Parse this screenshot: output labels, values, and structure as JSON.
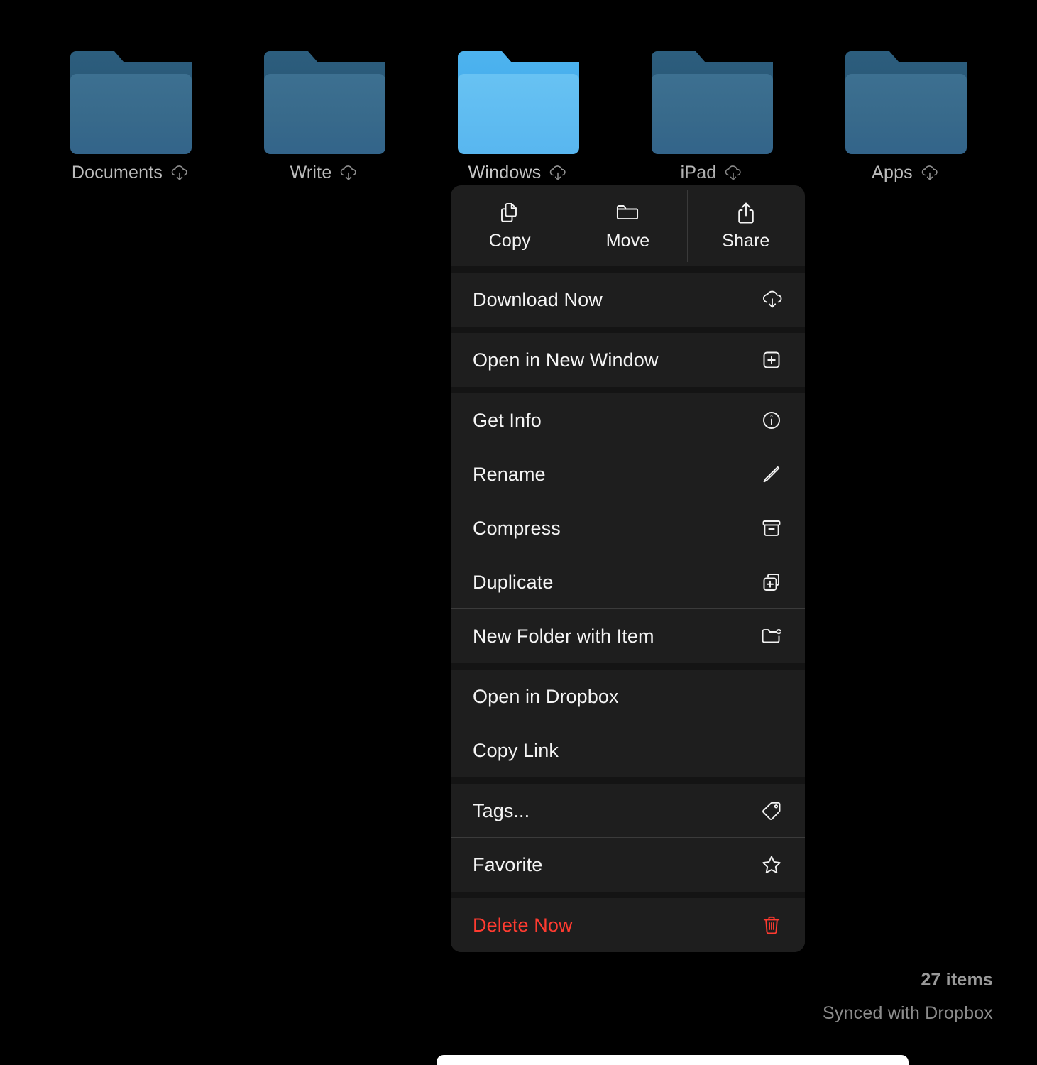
{
  "desktop": {
    "folders": [
      {
        "label": "Documents",
        "badge_icon": "cloud-download-icon",
        "selected": false
      },
      {
        "label": "Write",
        "badge_icon": "cloud-download-icon",
        "selected": false
      },
      {
        "label": "Windows",
        "badge_icon": "cloud-download-icon",
        "selected": true
      },
      {
        "label": "iPad",
        "badge_icon": "cloud-download-icon",
        "selected": false
      },
      {
        "label": "Apps",
        "badge_icon": "cloud-download-icon",
        "selected": false
      }
    ]
  },
  "context_menu": {
    "actions": [
      {
        "label": "Copy",
        "icon": "copy-documents-icon"
      },
      {
        "label": "Move",
        "icon": "folder-icon"
      },
      {
        "label": "Share",
        "icon": "share-up-arrow-icon"
      }
    ],
    "groups": [
      {
        "items": [
          {
            "label": "Download Now",
            "icon": "cloud-download-icon",
            "danger": false
          }
        ]
      },
      {
        "items": [
          {
            "label": "Open in New Window",
            "icon": "plus-square-icon",
            "danger": false
          }
        ]
      },
      {
        "items": [
          {
            "label": "Get Info",
            "icon": "info-circle-icon",
            "danger": false
          },
          {
            "label": "Rename",
            "icon": "pencil-icon",
            "danger": false
          },
          {
            "label": "Compress",
            "icon": "archive-box-icon",
            "danger": false
          },
          {
            "label": "Duplicate",
            "icon": "duplicate-squares-icon",
            "danger": false
          },
          {
            "label": "New Folder with Item",
            "icon": "new-folder-plus-icon",
            "danger": false
          }
        ]
      },
      {
        "items": [
          {
            "label": "Open in Dropbox",
            "icon": "",
            "danger": false
          },
          {
            "label": "Copy Link",
            "icon": "",
            "danger": false
          }
        ]
      },
      {
        "items": [
          {
            "label": "Tags...",
            "icon": "tag-icon",
            "danger": false
          },
          {
            "label": "Favorite",
            "icon": "star-outline-icon",
            "danger": false
          }
        ]
      },
      {
        "items": [
          {
            "label": "Delete Now",
            "icon": "trash-icon",
            "danger": true
          }
        ]
      }
    ]
  },
  "status": {
    "item_count": "27 items",
    "sync_state": "Synced with Dropbox"
  },
  "colors": {
    "background": "#000000",
    "menu_surface": "#1e1e1e",
    "menu_gap": "#141414",
    "separator": "#3b3b3b",
    "text_primary": "#f5f5f5",
    "text_secondary": "#8c8c8c",
    "danger": "#ff3b30",
    "folder_blue": "#3d7091",
    "folder_blue_selected": "#68c2f3"
  }
}
